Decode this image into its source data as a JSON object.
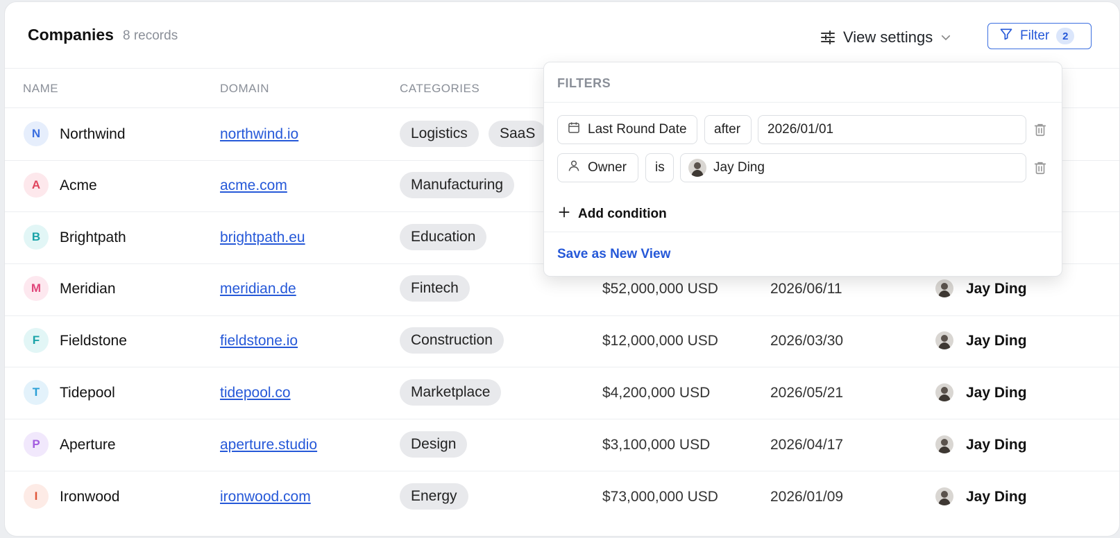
{
  "header": {
    "title": "Companies",
    "count": "8 records",
    "view_settings_label": "View settings",
    "filter_label": "Filter",
    "filter_count": "2"
  },
  "columns": {
    "name": "NAME",
    "domain": "DOMAIN",
    "categories": "CATEGORIES"
  },
  "rows": [
    {
      "initial": "N",
      "name": "Northwind",
      "domain": "northwind.io",
      "categories": [
        "Logistics",
        "SaaS"
      ],
      "funding": "",
      "date": "",
      "owner": ""
    },
    {
      "initial": "A",
      "name": "Acme",
      "domain": "acme.com",
      "categories": [
        "Manufacturing"
      ],
      "funding": "",
      "date": "",
      "owner": ""
    },
    {
      "initial": "B",
      "name": "Brightpath",
      "domain": "brightpath.eu",
      "categories": [
        "Education"
      ],
      "funding": "",
      "date": "",
      "owner": ""
    },
    {
      "initial": "M",
      "name": "Meridian",
      "domain": "meridian.de",
      "categories": [
        "Fintech"
      ],
      "funding": "$52,000,000 USD",
      "date": "2026/06/11",
      "owner": "Jay Ding"
    },
    {
      "initial": "F",
      "name": "Fieldstone",
      "domain": "fieldstone.io",
      "categories": [
        "Construction"
      ],
      "funding": "$12,000,000 USD",
      "date": "2026/03/30",
      "owner": "Jay Ding"
    },
    {
      "initial": "T",
      "name": "Tidepool",
      "domain": "tidepool.co",
      "categories": [
        "Marketplace"
      ],
      "funding": "$4,200,000 USD",
      "date": "2026/05/21",
      "owner": "Jay Ding"
    },
    {
      "initial": "P",
      "name": "Aperture",
      "domain": "aperture.studio",
      "categories": [
        "Design"
      ],
      "funding": "$3,100,000 USD",
      "date": "2026/04/17",
      "owner": "Jay Ding"
    },
    {
      "initial": "I",
      "name": "Ironwood",
      "domain": "ironwood.com",
      "categories": [
        "Energy"
      ],
      "funding": "$73,000,000 USD",
      "date": "2026/01/09",
      "owner": "Jay Ding"
    }
  ],
  "filters_popover": {
    "title": "FILTERS",
    "conditions": [
      {
        "field": "Last Round Date",
        "operator": "after",
        "value": "2026/01/01",
        "field_icon": "calendar-icon"
      },
      {
        "field": "Owner",
        "operator": "is",
        "value": "Jay Ding",
        "field_icon": "person-icon"
      }
    ],
    "add_condition_label": "Add condition",
    "save_view_label": "Save as New View"
  },
  "colors": {
    "accent": "#2558d8",
    "chip_bg": "#e8e9ec",
    "avatar_N": "#3b6fe0",
    "avatar_A": "#e0455d",
    "avatar_B": "#1aa3a8",
    "avatar_M": "#e0457a",
    "avatar_F": "#1aa3a8",
    "avatar_T": "#2a9fd6",
    "avatar_P": "#a35ce0",
    "avatar_I": "#e0573a"
  }
}
